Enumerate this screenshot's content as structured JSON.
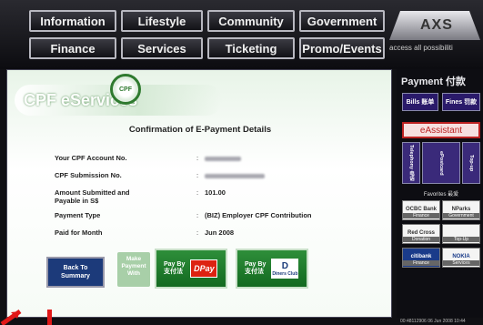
{
  "nav": {
    "row1": [
      "Information",
      "Lifestyle",
      "Community",
      "Government"
    ],
    "row2": [
      "Finance",
      "Services",
      "Ticketing",
      "Promo/Events"
    ]
  },
  "brand": {
    "logo_text": "AXS",
    "tagline": "access all possibiliti"
  },
  "cpf": {
    "title": "CPF eServices",
    "seal_text": "CPF"
  },
  "confirmation": {
    "title": "Confirmation of E-Payment Details",
    "fields": [
      {
        "label": "Your CPF Account No.",
        "value": ""
      },
      {
        "label": "CPF Submission No.",
        "value": ""
      },
      {
        "label": "Amount Submitted and Payable in S$",
        "value": "101.00"
      },
      {
        "label": "Payment Type",
        "value": "(BIZ) Employer CPF Contribution"
      },
      {
        "label": "Paid for Month",
        "value": "Jun 2008"
      }
    ]
  },
  "buttons": {
    "back": "Back To Summary",
    "make_payment": "Make Payment With",
    "pay_by": "Pay By",
    "pay_by_cn": "支付法",
    "dpay": "DPay",
    "diners": "D",
    "diners_sub": "Diners Club"
  },
  "sidebar": {
    "payment_title": "Payment 付款",
    "bills": "Bills 账单",
    "fines": "Fines 罚款",
    "eassistant": "eAssistant",
    "tabs": [
      "Telephony 电话",
      "ePostcard",
      "Top-up"
    ],
    "favorites": "Favorites 最爱",
    "tiles": [
      {
        "name": "OCBC Bank",
        "sub": "Finance"
      },
      {
        "name": "NParks",
        "sub": "Government"
      },
      {
        "name": "Red Cross",
        "sub": "Donation"
      },
      {
        "name": "",
        "sub": "Top-Up"
      },
      {
        "name": "citibank",
        "sub": "Finance"
      },
      {
        "name": "NOKIA",
        "sub": "Services"
      }
    ]
  },
  "footer": {
    "text": "00:48112906   06 Jun 2008   10:44"
  },
  "colors": {
    "accent_green": "#136a20",
    "brand_red": "#d21",
    "nav_bg": "#121216"
  }
}
